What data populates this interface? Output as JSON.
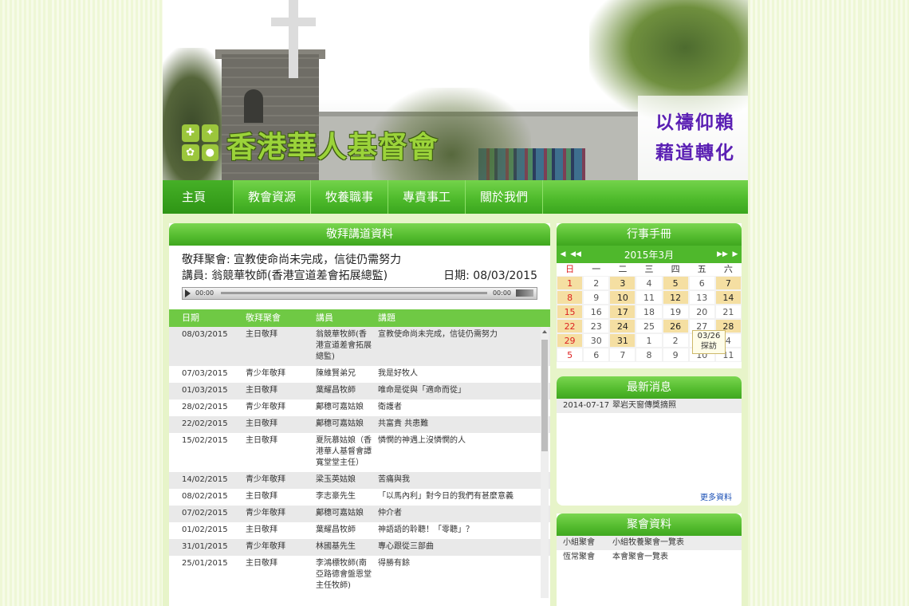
{
  "header": {
    "church_name": "香港華人基督會",
    "motto_line1": "以禱仰賴",
    "motto_line2": "藉道轉化",
    "logo_icons": [
      "cross-icon",
      "dove-icon",
      "flower-icon",
      "lamp-icon"
    ]
  },
  "nav": {
    "items": [
      {
        "label": "主頁"
      },
      {
        "label": "教會資源"
      },
      {
        "label": "牧養職事"
      },
      {
        "label": "專責事工"
      },
      {
        "label": "關於我們"
      }
    ]
  },
  "sermon": {
    "title": "敬拜講道資料",
    "current_line1": "敬拜聚會: 宣教使命尚未完成，信徒仍需努力",
    "current_speaker": "講員: 翁競華牧師(香港宣道差會拓展總監)",
    "current_date": "日期: 08/03/2015",
    "player_time_start": "00:00",
    "player_time_end": "00:00",
    "columns": {
      "date": "日期",
      "type": "敬拜聚會",
      "speaker": "講員",
      "topic": "講題"
    },
    "rows": [
      {
        "date": "08/03/2015",
        "type": "主日敬拜",
        "speaker": "翁競華牧師(香港宣道差會拓展總監)",
        "topic": "宣教使命尚未完成，信徒仍需努力"
      },
      {
        "date": "07/03/2015",
        "type": "青少年敬拜",
        "speaker": "陳維賢弟兄",
        "topic": "我是好牧人"
      },
      {
        "date": "01/03/2015",
        "type": "主日敬拜",
        "speaker": "葉耀昌牧師",
        "topic": "唯命是從與「適命而從」"
      },
      {
        "date": "28/02/2015",
        "type": "青少年敬拜",
        "speaker": "鄺穗可嘉姑娘",
        "topic": "衛護者"
      },
      {
        "date": "22/02/2015",
        "type": "主日敬拜",
        "speaker": "鄺穗可嘉姑娘",
        "topic": "共富貴 共患難"
      },
      {
        "date": "15/02/2015",
        "type": "主日敬拜",
        "speaker": "夏阮慕姑娘（香港華人基督會譚寬堂堂主任）",
        "topic": "憐憫的神遇上沒憐憫的人"
      },
      {
        "date": "14/02/2015",
        "type": "青少年敬拜",
        "speaker": "梁玉英姑娘",
        "topic": "苦痛與我"
      },
      {
        "date": "08/02/2015",
        "type": "主日敬拜",
        "speaker": "李志豪先生",
        "topic": "「以馬內利」對今日的我們有甚麼意義"
      },
      {
        "date": "07/02/2015",
        "type": "青少年敬拜",
        "speaker": "鄺穗可嘉姑娘",
        "topic": "仲介者"
      },
      {
        "date": "01/02/2015",
        "type": "主日敬拜",
        "speaker": "葉耀昌牧師",
        "topic": "神語語的聆聽！「零聽」？"
      },
      {
        "date": "31/01/2015",
        "type": "青少年敬拜",
        "speaker": "林國基先生",
        "topic": "專心跟從三部曲"
      },
      {
        "date": "25/01/2015",
        "type": "主日敬拜",
        "speaker": "李鴻標牧師(南亞路德會盤恩堂主任牧師)",
        "topic": "得勝有餘"
      }
    ]
  },
  "calendar": {
    "title": "行事手冊",
    "month": "2015年3月",
    "prev_year": "◀◀",
    "prev_month": "◀",
    "next_month": "▶",
    "next_year": "▶▶",
    "weekdays": [
      "日",
      "一",
      "二",
      "三",
      "四",
      "五",
      "六"
    ],
    "weeks": [
      [
        {
          "d": "1",
          "ev": true
        },
        {
          "d": "2"
        },
        {
          "d": "3",
          "ev": true
        },
        {
          "d": "4"
        },
        {
          "d": "5",
          "ev": true
        },
        {
          "d": "6"
        },
        {
          "d": "7",
          "ev": true
        }
      ],
      [
        {
          "d": "8",
          "ev": true
        },
        {
          "d": "9"
        },
        {
          "d": "10",
          "ev": true
        },
        {
          "d": "11"
        },
        {
          "d": "12",
          "ev": true
        },
        {
          "d": "13"
        },
        {
          "d": "14",
          "ev": true
        }
      ],
      [
        {
          "d": "15",
          "ev": true
        },
        {
          "d": "16"
        },
        {
          "d": "17",
          "ev": true
        },
        {
          "d": "18"
        },
        {
          "d": "19"
        },
        {
          "d": "20"
        },
        {
          "d": "21"
        }
      ],
      [
        {
          "d": "22",
          "ev": true
        },
        {
          "d": "23"
        },
        {
          "d": "24",
          "ev": true
        },
        {
          "d": "25"
        },
        {
          "d": "26",
          "ev": true
        },
        {
          "d": "27"
        },
        {
          "d": "28",
          "ev": true
        }
      ],
      [
        {
          "d": "29",
          "ev": true
        },
        {
          "d": "30"
        },
        {
          "d": "31",
          "ev": true
        },
        {
          "d": "1"
        },
        {
          "d": "2"
        },
        {
          "d": "3"
        },
        {
          "d": "4"
        }
      ],
      [
        {
          "d": "5"
        },
        {
          "d": "6"
        },
        {
          "d": "7"
        },
        {
          "d": "8"
        },
        {
          "d": "9"
        },
        {
          "d": "10"
        },
        {
          "d": "11"
        }
      ]
    ],
    "tooltip_date": "03/26",
    "tooltip_text": "探訪"
  },
  "news": {
    "title": "最新消息",
    "items": [
      {
        "date": "2014-07-17",
        "text": "翠岩天窗傳獎摘照"
      }
    ],
    "more": "更多資料"
  },
  "gatherings": {
    "title": "聚會資料",
    "items": [
      {
        "name": "小組聚會",
        "desc": "小組牧養聚會一覽表"
      },
      {
        "name": "恆常聚會",
        "desc": "本會聚會一覽表"
      }
    ]
  },
  "colors": {
    "accent_green": "#4fbb2c",
    "event_day": "#f5dfa2",
    "motto_purple": "#5a1fb3"
  }
}
